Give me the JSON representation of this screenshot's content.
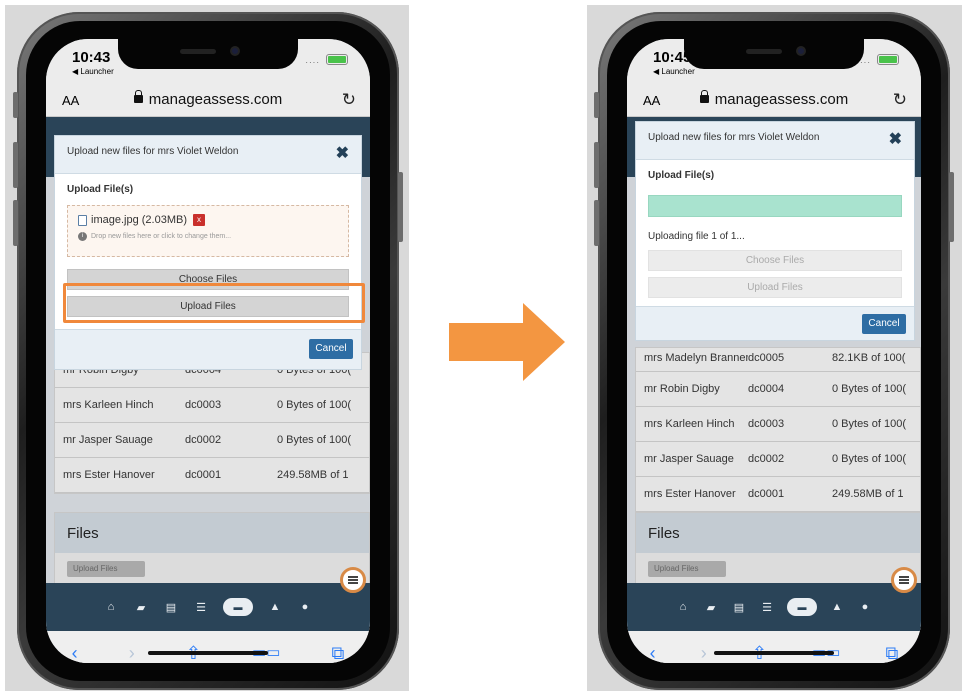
{
  "arrow_color": "#f39641",
  "highlight_color": "#f0883b",
  "nav_color": "#2a4458",
  "left": {
    "status": {
      "time": "10:43",
      "back_label": "◀ Launcher",
      "signal": "····"
    },
    "browser": {
      "text_size": "AA",
      "url": "manageassess.com",
      "reload_icon": "reload-icon"
    },
    "modal": {
      "title": "Upload new files for mrs Violet Weldon",
      "close": "✖",
      "section_label": "Upload File(s)",
      "file_name": "image.jpg (2.03MB)",
      "remove": "x",
      "hint": "Drop new files here or click to change them...",
      "choose_label": "Choose Files",
      "upload_label": "Upload Files",
      "cancel_label": "Cancel"
    },
    "rows": [
      {
        "name": "mr Robin Digby",
        "id": "dc0004",
        "size": "0 Bytes of 100("
      },
      {
        "name": "mrs Karleen Hinch",
        "id": "dc0003",
        "size": "0 Bytes of 100("
      },
      {
        "name": "mr Jasper Sauage",
        "id": "dc0002",
        "size": "0 Bytes of 100("
      },
      {
        "name": "mrs Ester Hanover",
        "id": "dc0001",
        "size": "249.58MB of 1"
      }
    ],
    "files_heading": "Files",
    "files_button_partial": "Upload Files"
  },
  "right": {
    "status": {
      "time": "10:45",
      "back_label": "◀ Launcher",
      "signal": "····"
    },
    "browser": {
      "text_size": "AA",
      "url": "manageassess.com"
    },
    "modal": {
      "title": "Upload new files for mrs Violet Weldon",
      "close": "✖",
      "section_label": "Upload File(s)",
      "progress": 1.0,
      "uploading_text": "Uploading file 1 of 1...",
      "choose_label": "Choose Files",
      "upload_label": "Upload Files",
      "cancel_label": "Cancel"
    },
    "partial_row": {
      "name": "mrs Madelyn Brannen",
      "id": "dc0005",
      "size": "82.1KB of 100("
    },
    "rows": [
      {
        "name": "mr Robin Digby",
        "id": "dc0004",
        "size": "0 Bytes of 100("
      },
      {
        "name": "mrs Karleen Hinch",
        "id": "dc0003",
        "size": "0 Bytes of 100("
      },
      {
        "name": "mr Jasper Sauage",
        "id": "dc0002",
        "size": "0 Bytes of 100("
      },
      {
        "name": "mrs Ester Hanover",
        "id": "dc0001",
        "size": "249.58MB of 1"
      }
    ],
    "files_heading": "Files",
    "files_button_partial": "Upload Files"
  },
  "app_nav_icons": [
    "home-icon",
    "book-icon",
    "id-card-icon",
    "list-icon",
    "folder-icon",
    "graduation-cap-icon",
    "users-icon"
  ],
  "safari_toolbar": {
    "back": "‹",
    "forward": "›",
    "share": "⇧",
    "bookmarks": "📖",
    "tabs": "⧉"
  }
}
